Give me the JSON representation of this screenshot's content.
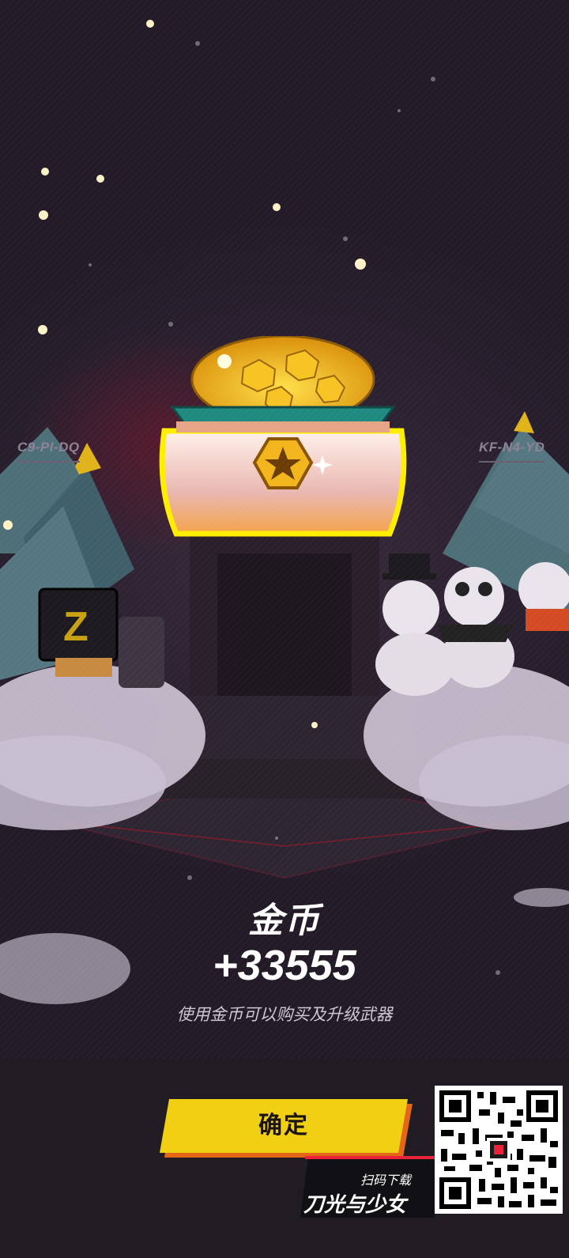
{
  "scene": {
    "left_code": "C9-PI-DQ",
    "right_code": "KF-N4-YD"
  },
  "reward": {
    "title": "金币",
    "amount": "+33555",
    "description": "使用金币可以购买及升级武器"
  },
  "actions": {
    "confirm_label": "确定"
  },
  "promo": {
    "scan_label": "扫码下载",
    "game_title": "刀光与少女"
  },
  "colors": {
    "button": "#f1cf12",
    "button_shadow": "#e46617",
    "gold": "#f2c21a",
    "accent_red": "#e8233a"
  }
}
